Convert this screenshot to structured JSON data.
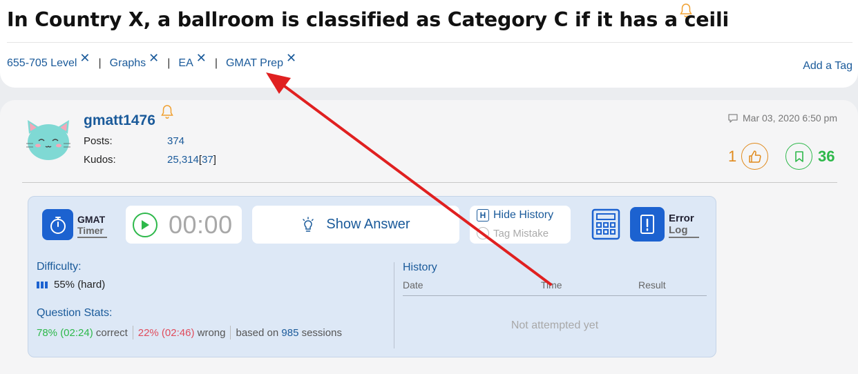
{
  "question": {
    "title": "In Country X, a ballroom is classified as Category C if it has a ceili"
  },
  "tags": [
    {
      "label": "655-705 Level"
    },
    {
      "label": "Graphs"
    },
    {
      "label": "EA"
    },
    {
      "label": "GMAT Prep"
    }
  ],
  "tag_separator": "|",
  "tag_remove_glyph": "✕",
  "add_tag_label": "Add a Tag",
  "post": {
    "username": "gmatt1476",
    "posts_label": "Posts:",
    "posts_value": "374",
    "kudos_label": "Kudos:",
    "kudos_value": "25,314",
    "kudos_bracket_open": "[",
    "kudos_extra": "37",
    "kudos_bracket_close": "]",
    "date": "Mar 03, 2020 6:50 pm",
    "kudos_count": "1",
    "bookmark_count": "36"
  },
  "toolbar": {
    "timer_line1": "GMAT",
    "timer_line2": "Timer",
    "timer_display": "00:00",
    "show_answer_label": "Show Answer",
    "hide_history_badge": "H",
    "hide_history_label": "Hide History",
    "tag_mistake_label": "Tag Mistake",
    "error_line1": "Error",
    "error_line2": "Log"
  },
  "stats": {
    "difficulty_label": "Difficulty:",
    "difficulty_value": "55% (hard)",
    "question_stats_label": "Question Stats:",
    "correct_value": "78% (02:24)",
    "correct_word": "correct",
    "wrong_value": "22% (02:46)",
    "wrong_word": "wrong",
    "based_on": "based on",
    "sessions_count": "985",
    "sessions_word": "sessions"
  },
  "history": {
    "title": "History",
    "columns": [
      "Date",
      "Time",
      "Result"
    ],
    "empty_text": "Not attempted yet"
  },
  "colors": {
    "link_blue": "#1a5a9a",
    "brand_blue": "#1c62d0",
    "kudos_orange": "#e08a1c",
    "bookmark_green": "#2db84a",
    "annotation_red": "#e02020"
  },
  "icons": [
    "bell-icon",
    "tag-remove-icon",
    "avatar-cat",
    "comment-icon",
    "thumbs-up-icon",
    "bookmark-icon",
    "stopwatch-icon",
    "play-icon",
    "lightbulb-icon",
    "calculator-icon",
    "error-log-icon",
    "difficulty-bars-icon"
  ]
}
